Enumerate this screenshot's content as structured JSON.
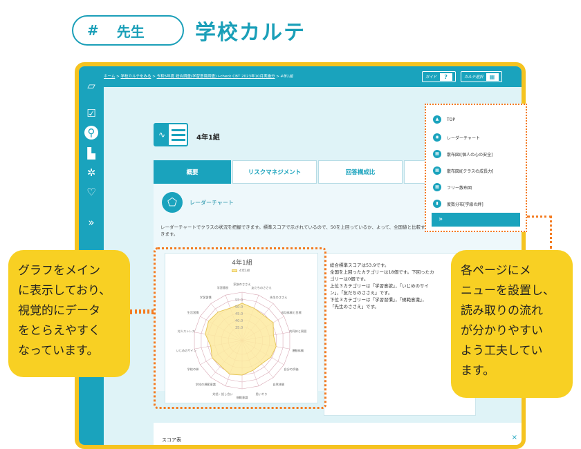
{
  "header": {
    "hash": "#",
    "role": "先生",
    "title": "学校カルテ"
  },
  "breadcrumb": {
    "home": "ホーム",
    "sep": " > ",
    "item1": "学校カルテをみる",
    "item2": "令和5年度 総合調査(学習意識調査) i-check CBT 2023年10月実施分",
    "item3": "4年1組"
  },
  "topbar": {
    "guide_label": "ガイド",
    "guide_icon": "?",
    "karte_label": "カルテ選択"
  },
  "class_name": "4年1組",
  "tabs": [
    "概要",
    "リスクマネジメント",
    "回答構成比"
  ],
  "section": {
    "title": "レーダーチャート",
    "description": "レーダーチャートでクラスの状況を把握できます。標準スコアで示されているので、50を上回っているか、よって、全国値と比較することができます。"
  },
  "chart": {
    "title": "4年1組",
    "legend": "4年1組",
    "center_value": "25.0",
    "ring_values": [
      "55.0",
      "50.0",
      "45.0",
      "40.0",
      "35.0"
    ],
    "fill_color": "#fdeaa0",
    "stroke_color": "#e6c75a",
    "grid_color": "#d9a9b5"
  },
  "chart_data": {
    "type": "radar",
    "title": "4年1組",
    "series": [
      {
        "name": "4年1組",
        "values": [
          52,
          50,
          49,
          51,
          48,
          50,
          49,
          47,
          48,
          50,
          51,
          49,
          50,
          48,
          52,
          53
        ]
      }
    ],
    "categories": [
      "家族のささえ",
      "友だちのささえ",
      "先生のささえ",
      "成功体験と目標",
      "共同体と周囲",
      "運動体験",
      "自分の評価",
      "自然体験",
      "思いやり",
      "規範意識",
      "対話・話し合い",
      "学校の規範意識",
      "学校の絆",
      "いじめのサイン",
      "対人ストレス",
      "生活習慣",
      "学習習慣",
      "学習意欲"
    ],
    "rlim": [
      25,
      60
    ]
  },
  "summary": [
    "総合標準スコアは53.9です。",
    "全国を上回ったカテゴリーは18個です。下回ったカ",
    "ゴリーは0個です。",
    "上位３カテゴリーは「学習意欲」，「いじめのサイ",
    "ン」，「友だちのささえ」です。",
    "下位３カテゴリーは「学習習慣」，「規範意識」，",
    "「先生のささえ」です。"
  ],
  "score_table": {
    "title": "スコア表",
    "close": "×"
  },
  "menu": {
    "items": [
      "TOP",
      "レーダーチャート",
      "散布図Ⅰ[個人の心の安全]",
      "散布図Ⅱ[クラスの成長力]",
      "フリー散布図",
      "度数分布[学級の絆]"
    ],
    "expand": "»"
  },
  "callouts": {
    "left": [
      "グラフをメイン",
      "に表示しており、",
      "視覚的にデータ",
      "をとらえやすく",
      "なっています。"
    ],
    "right": [
      "各ページにメ",
      "ニューを設置し、",
      "読み取りの流れ",
      "が分かりやすい",
      "よう工夫してい",
      "ます。"
    ]
  },
  "sidebar": [
    "chart-icon",
    "checklist-icon",
    "search-icon",
    "bar-icon",
    "gear-icon",
    "heart-icon",
    "expand-icon"
  ]
}
